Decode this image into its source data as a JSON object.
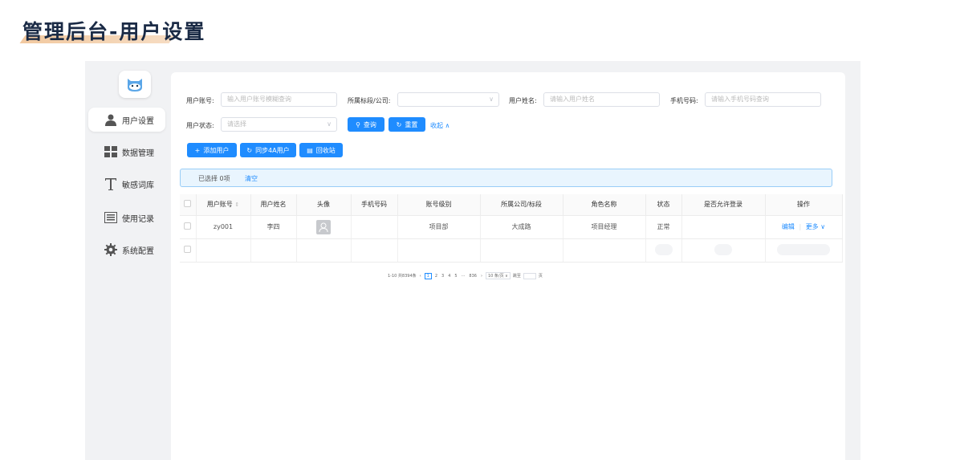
{
  "page": {
    "title": "管理后台-用户设置"
  },
  "sidebar": {
    "items": [
      {
        "label": "用户设置",
        "icon": "user-icon"
      },
      {
        "label": "数据管理",
        "icon": "grid-icon"
      },
      {
        "label": "敏感词库",
        "icon": "text-icon"
      },
      {
        "label": "使用记录",
        "icon": "list-icon"
      },
      {
        "label": "系统配置",
        "icon": "gear-icon"
      }
    ]
  },
  "filters": {
    "account_label": "用户账号:",
    "account_placeholder": "输入用户账号模糊查询",
    "org_label": "所属标段/公司:",
    "org_value": "",
    "name_label": "用户姓名:",
    "name_placeholder": "请输入用户姓名",
    "phone_label": "手机号码:",
    "phone_placeholder": "请输入手机号码查询",
    "status_label": "用户状态:",
    "status_placeholder": "请选择",
    "search_button": "查询",
    "reset_button": "重置",
    "collapse_link": "收起"
  },
  "toolbar": {
    "add_user": "添加用户",
    "sync_4a": "同步4A用户",
    "recycle_bin": "回收站"
  },
  "selection": {
    "text": "已选择 0项",
    "clear": "清空"
  },
  "table": {
    "headers": [
      "用户账号",
      "用户姓名",
      "头像",
      "手机号码",
      "账号级别",
      "所属公司/标段",
      "角色名称",
      "状态",
      "是否允许登录",
      "操作"
    ],
    "rows": [
      {
        "account": "zy001",
        "name": "李四",
        "phone": "",
        "level": "项目部",
        "org": "大成路",
        "role": "项目经理",
        "status": "正常",
        "allow_login": "",
        "edit": "编辑",
        "more": "更多"
      }
    ]
  },
  "pagination": {
    "summary": "1-10 共8394条",
    "pages": [
      "1",
      "2",
      "3",
      "4",
      "5",
      "···",
      "836"
    ],
    "page_size": "10 条/页",
    "goto_label": "跳至",
    "page_unit": "页"
  },
  "colors": {
    "primary": "#1f8cff",
    "title": "#1a2a45",
    "accent": "#f2c9a0"
  }
}
